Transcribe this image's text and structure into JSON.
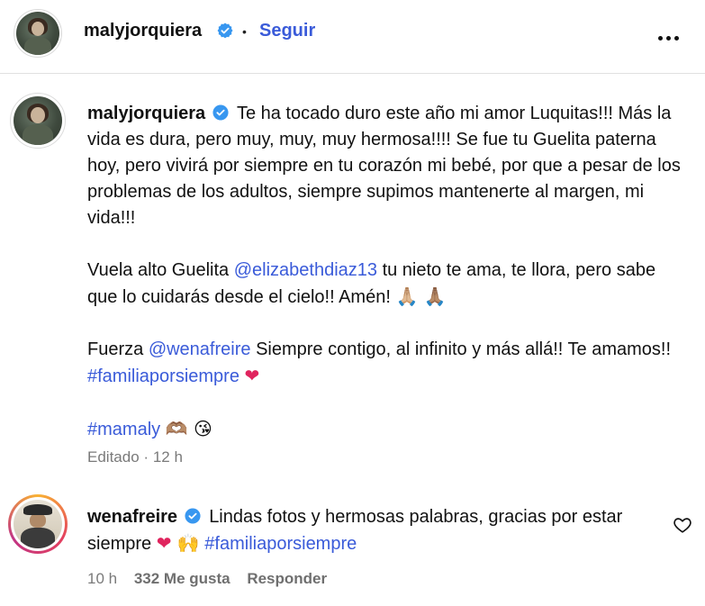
{
  "header": {
    "username": "malyjorquiera",
    "separator": "•",
    "follow_label": "Seguir",
    "more_icon": "more-horizontal-icon"
  },
  "caption": {
    "username": "malyjorquiera",
    "p1": "Te ha tocado duro este año mi amor Luquitas!!! Más la vida es dura, pero muy, muy, muy hermosa!!!! Se fue tu Guelita paterna hoy, pero vivirá por siempre en tu corazón mi bebé, por que a pesar de los problemas de los adultos, siempre supimos mantenerte al margen, mi vida!!!",
    "p2_a": "Vuela alto Guelita",
    "p2_mention": "@elizabethdiaz13",
    "p2_b": "tu nieto te ama, te llora, pero sabe que lo cuidarás desde el cielo!! Amén!",
    "p2_emoji": "🙏🏼 🙏🏽",
    "p3_a": "Fuerza",
    "p3_mention": "@wenafreire",
    "p3_b": "Siempre contigo, al infinito y más allá!! Te amamos!!",
    "p3_hashtag": "#familiaporsiempre",
    "p3_emoji": "❤",
    "p4_hashtag": "#mamaly",
    "p4_emoji": "🫶🏽 😘"
  },
  "caption_meta": {
    "edited": "Editado",
    "dot": "·",
    "time": "12 h"
  },
  "comment": {
    "username": "wenafreire",
    "text": "Lindas fotos y hermosas palabras, gracias por estar siempre",
    "emoji": "❤ 🙌",
    "hashtag": "#familiaporsiempre",
    "time": "10 h",
    "likes": "332 Me gusta",
    "reply_label": "Responder",
    "like_icon": "heart-outline-icon"
  },
  "colors": {
    "link": "#3a5bd9",
    "verified": "#3897f0",
    "meta": "#7a7a7a"
  }
}
